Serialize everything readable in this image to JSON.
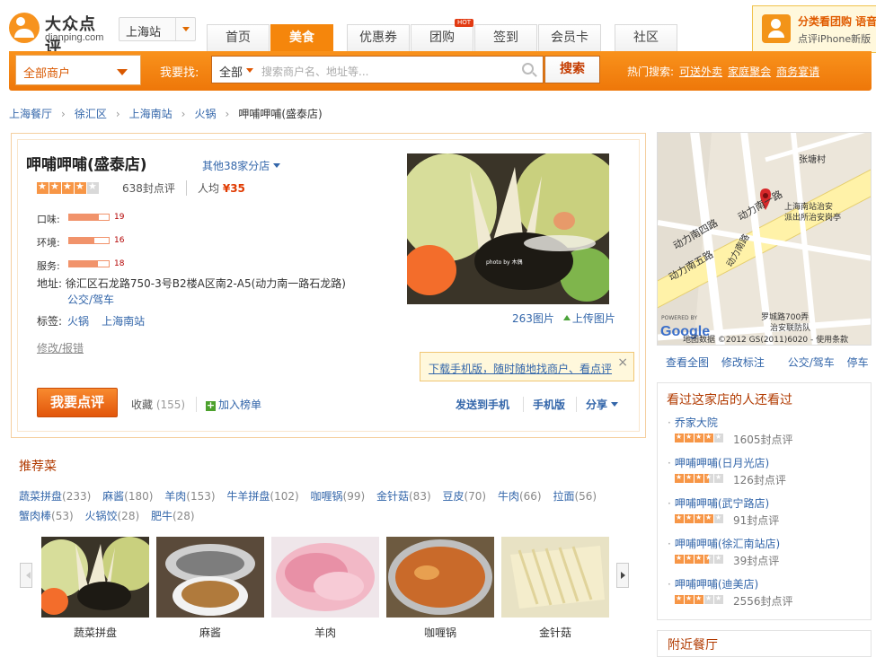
{
  "header": {
    "logo_cn": "大众点评",
    "logo_en": "dianping.com",
    "city": "上海站",
    "tabs": [
      "首页",
      "美食",
      "优惠券",
      "团购",
      "签到",
      "会员卡",
      "社区"
    ],
    "active_tab": "美食",
    "hot_badge": "HOT",
    "promo_title": "分类看团购 语音",
    "promo_sub": "点评iPhone新版"
  },
  "search": {
    "scope": "全部商户",
    "lookfor_label": "我要找:",
    "category": "全部",
    "placeholder": "搜索商户名、地址等...",
    "button": "搜索",
    "hot_label": "热门搜索:",
    "hot_keywords": [
      "可送外卖",
      "家庭聚会",
      "商务宴请"
    ]
  },
  "breadcrumb": [
    "上海餐厅",
    "徐汇区",
    "上海南站",
    "火锅",
    "呷哺呷哺(盛泰店)"
  ],
  "shop": {
    "name": "呷哺呷哺(盛泰店)",
    "branches": "其他38家分店",
    "rating_stars": 4,
    "review_count": "638封点评",
    "avg_price_label": "人均",
    "avg_price": "¥35",
    "scores": [
      {
        "label": "口味:",
        "value": "19",
        "fill_ratio": 0.76
      },
      {
        "label": "环境:",
        "value": "16",
        "fill_ratio": 0.64
      },
      {
        "label": "服务:",
        "value": "18",
        "fill_ratio": 0.72
      }
    ],
    "address_label": "地址:",
    "address": "徐汇区石龙路750-3号B2楼A区南2-A5(动力南一路石龙路)",
    "bus_link": "公交/驾车",
    "tags_label": "标签:",
    "tags": [
      "火锅",
      "上海南站"
    ],
    "edit_link": "修改/报错",
    "photo_count": "263图片",
    "upload_link": "上传图片",
    "photo_watermark": "photo by 木偶",
    "tip_text": "下载手机版，随时随地找商户、看点评",
    "tip_close": "×",
    "review_button": "我要点评",
    "favorite_label": "收藏",
    "favorite_count": "(155)",
    "add_list": "加入榜单",
    "send_phone": "发送到手机",
    "mobile": "手机版",
    "share": "分享"
  },
  "recommended": {
    "title": "推荐菜",
    "dishes": [
      {
        "name": "蔬菜拼盘",
        "count": "(233)"
      },
      {
        "name": "麻酱",
        "count": "(180)"
      },
      {
        "name": "羊肉",
        "count": "(153)"
      },
      {
        "name": "牛羊拼盘",
        "count": "(102)"
      },
      {
        "name": "咖喱锅",
        "count": "(99)"
      },
      {
        "name": "金针菇",
        "count": "(83)"
      },
      {
        "name": "豆皮",
        "count": "(70)"
      },
      {
        "name": "牛肉",
        "count": "(66)"
      },
      {
        "name": "拉面",
        "count": "(56)"
      },
      {
        "name": "蟹肉棒",
        "count": "(53)"
      },
      {
        "name": "火锅饺",
        "count": "(28)"
      },
      {
        "name": "肥牛",
        "count": "(28)"
      }
    ],
    "photos": [
      "蔬菜拼盘",
      "麻酱",
      "羊肉",
      "咖喱锅",
      "金针菇"
    ]
  },
  "map": {
    "labels": [
      "张塘村",
      "上海南站治安",
      "派出所治安岗亭",
      "动力南一路",
      "动力南四路",
      "动力南五路",
      "动力南路",
      "罗城路700弄",
      "治安联防队"
    ],
    "powered": "POWERED BY",
    "google": "Google",
    "copyright": "地图数据 ©2012 GS(2011)6020 - 使用条款",
    "links": [
      "查看全图",
      "修改标注",
      "公交/驾车",
      "停车"
    ]
  },
  "sidebar": {
    "title": "看过这家店的人还看过",
    "items": [
      {
        "name": "乔家大院",
        "stars": 4,
        "reviews": "1605封点评"
      },
      {
        "name": "呷哺呷哺(日月光店)",
        "stars": 3.5,
        "reviews": "126封点评"
      },
      {
        "name": "呷哺呷哺(武宁路店)",
        "stars": 4,
        "reviews": "91封点评"
      },
      {
        "name": "呷哺呷哺(徐汇南站店)",
        "stars": 3.5,
        "reviews": "39封点评"
      },
      {
        "name": "呷哺呷哺(迪美店)",
        "stars": 3,
        "reviews": "2556封点评"
      }
    ],
    "nearby_title": "附近餐厅"
  },
  "colors": {
    "brand": "#f5860c",
    "link": "#3366aa",
    "price": "#e03a00",
    "section_title": "#b13a00"
  }
}
